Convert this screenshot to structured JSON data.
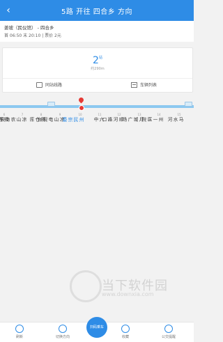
{
  "header": {
    "title": "5路 开往 四合乡 方向",
    "back_icon": "chevron-left-icon"
  },
  "route": {
    "from_to": "姜坡（民仪馆） - 四合乡",
    "times": "首 06:50 末 20:10 | 票价 2元"
  },
  "card": {
    "stops_away": "2",
    "stops_away_unit": "站",
    "distance": "约290m",
    "btn_same_stop": "同站线路",
    "btn_vehicle_list": "车辆列表"
  },
  "stops": [
    {
      "num": "6",
      "name": "招呼站"
    },
    {
      "num": "7",
      "name": "凉山农商银行"
    },
    {
      "num": "8",
      "name": "新仓库"
    },
    {
      "num": "9",
      "name": "凉山电视台"
    },
    {
      "num": "10",
      "name": "州民宗委"
    },
    {
      "num": "11",
      "name": "六中"
    },
    {
      "num": "12",
      "name": "顺河路口"
    },
    {
      "num": "13",
      "name": "月城广场"
    },
    {
      "num": "14",
      "name": "州一医院"
    },
    {
      "num": "15",
      "name": "马水河"
    }
  ],
  "bottom": {
    "refresh": "刷新",
    "switch": "切换方向",
    "scan": "扫码乘车",
    "favorite": "收藏",
    "alert": "公交提醒"
  },
  "watermark": {
    "text": "当下软件园",
    "url": "www.downxia.com"
  }
}
